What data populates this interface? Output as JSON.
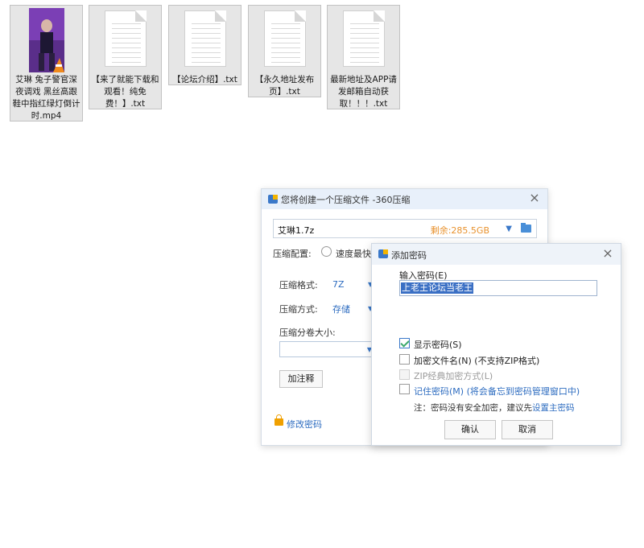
{
  "desktop": {
    "files": [
      {
        "name": "艾琳 兔子警官深夜调戏 黑丝高跟鞋中指红绿灯倒计时.mp4",
        "icon": "video-thumbnail"
      },
      {
        "name": "【来了就能下载和观看！纯免费！】.txt",
        "icon": "text-file-icon"
      },
      {
        "name": "【论坛介绍】.txt",
        "icon": "text-file-icon"
      },
      {
        "name": "【永久地址发布页】.txt",
        "icon": "text-file-icon"
      },
      {
        "name": "最新地址及APP请发邮箱自动获取！！！.txt",
        "icon": "text-file-icon"
      }
    ]
  },
  "main_dialog": {
    "title": "您将创建一个压缩文件 -360压缩",
    "filename": "艾琳1.7z",
    "free_space": "剩余:285.5GB",
    "config_label": "压缩配置:",
    "speed_option": "速度最快",
    "format_label": "压缩格式:",
    "format_value": "7Z",
    "method_label": "压缩方式:",
    "method_value": "存储",
    "split_label": "压缩分卷大小:",
    "comment_button": "加注释",
    "change_password_link": "修改密码"
  },
  "password_dialog": {
    "title": "添加密码",
    "input_label": "输入密码(E)",
    "password_value": "上老王论坛当老王",
    "options": [
      {
        "label": "显示密码(S)",
        "checked": true,
        "disabled": false
      },
      {
        "label": "加密文件名(N) (不支持ZIP格式)",
        "checked": false,
        "disabled": false
      },
      {
        "label": "ZIP经典加密方式(L)",
        "checked": false,
        "disabled": true
      },
      {
        "label": "记住密码(M) (将会备忘到密码管理窗口中)",
        "checked": false,
        "disabled": false
      }
    ],
    "note_prefix": "注：密码没有安全加密，建议先",
    "note_link": "设置主密码",
    "ok_button": "确认",
    "cancel_button": "取消"
  },
  "colors": {
    "accent": "#2d6cc0",
    "free_space": "#e8912c",
    "check": "#3aa86b"
  }
}
